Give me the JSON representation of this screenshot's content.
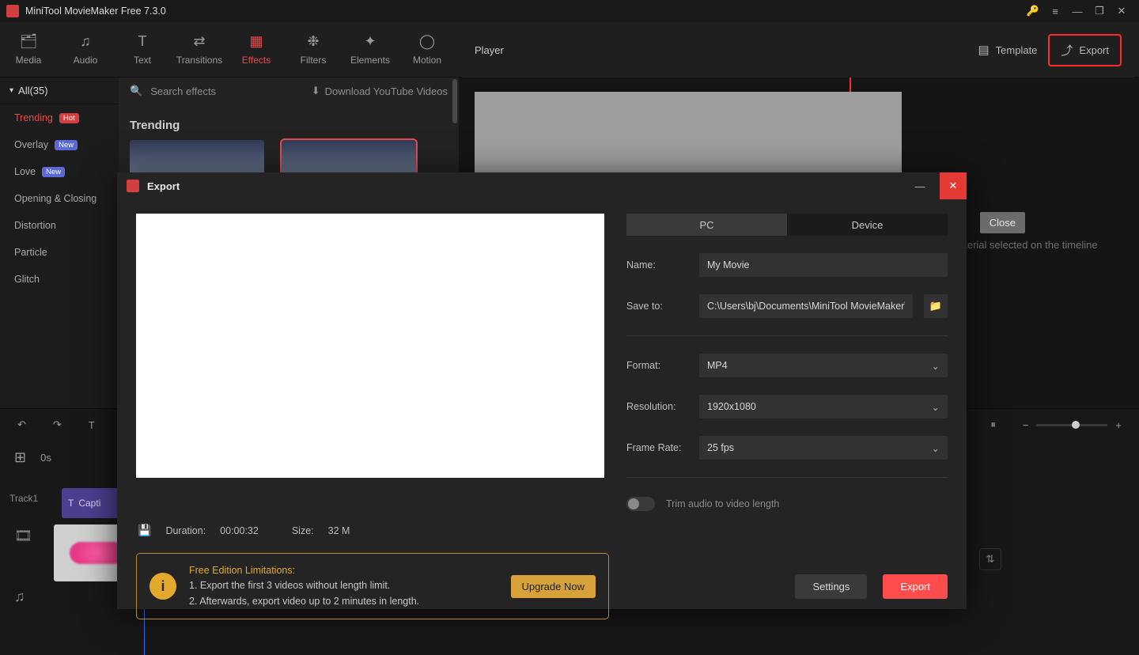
{
  "titlebar": {
    "title": "MiniTool MovieMaker Free 7.3.0"
  },
  "ribbon": {
    "items": [
      {
        "label": "Media",
        "icon": "🗂"
      },
      {
        "label": "Audio",
        "icon": "♫"
      },
      {
        "label": "Text",
        "icon": "T"
      },
      {
        "label": "Transitions",
        "icon": "⇄"
      },
      {
        "label": "Effects",
        "icon": "▦"
      },
      {
        "label": "Filters",
        "icon": "❉"
      },
      {
        "label": "Elements",
        "icon": "✦"
      },
      {
        "label": "Motion",
        "icon": "◯"
      }
    ],
    "active_index": 4
  },
  "right_header": {
    "player_label": "Player",
    "template_label": "Template",
    "export_label": "Export"
  },
  "sidebar": {
    "all_label": "All(35)",
    "items": [
      {
        "label": "Trending",
        "pill": "Hot",
        "pill_class": "hot",
        "hot": true
      },
      {
        "label": "Overlay",
        "pill": "New",
        "pill_class": "new"
      },
      {
        "label": "Love",
        "pill": "New",
        "pill_class": "new"
      },
      {
        "label": "Opening & Closing",
        "pill": ""
      },
      {
        "label": "Distortion",
        "pill": ""
      },
      {
        "label": "Particle",
        "pill": ""
      },
      {
        "label": "Glitch",
        "pill": ""
      }
    ]
  },
  "gallery": {
    "search_placeholder": "Search effects",
    "download_label": "Download YouTube Videos",
    "heading": "Trending"
  },
  "bg_hint": "aterial selected on the timeline",
  "timeline": {
    "time_label": "0s",
    "track_label": "Track1",
    "clip_label": "Capti"
  },
  "export_modal": {
    "title": "Export",
    "close_tooltip": "Close",
    "tabs": {
      "pc": "PC",
      "device": "Device"
    },
    "fields": {
      "name_label": "Name:",
      "name_value": "My Movie",
      "saveto_label": "Save to:",
      "saveto_value": "C:\\Users\\bj\\Documents\\MiniTool MovieMaker\\outp",
      "format_label": "Format:",
      "format_value": "MP4",
      "resolution_label": "Resolution:",
      "resolution_value": "1920x1080",
      "framerate_label": "Frame Rate:",
      "framerate_value": "25 fps",
      "trim_label": "Trim audio to video length"
    },
    "meta": {
      "duration_label": "Duration:",
      "duration_value": "00:00:32",
      "size_label": "Size:",
      "size_value": "32 M"
    },
    "limitations": {
      "heading": "Free Edition Limitations:",
      "line1": "1. Export the first 3 videos without length limit.",
      "line2": "2. Afterwards, export video up to 2 minutes in length.",
      "upgrade_label": "Upgrade Now"
    },
    "buttons": {
      "settings": "Settings",
      "export": "Export"
    }
  }
}
